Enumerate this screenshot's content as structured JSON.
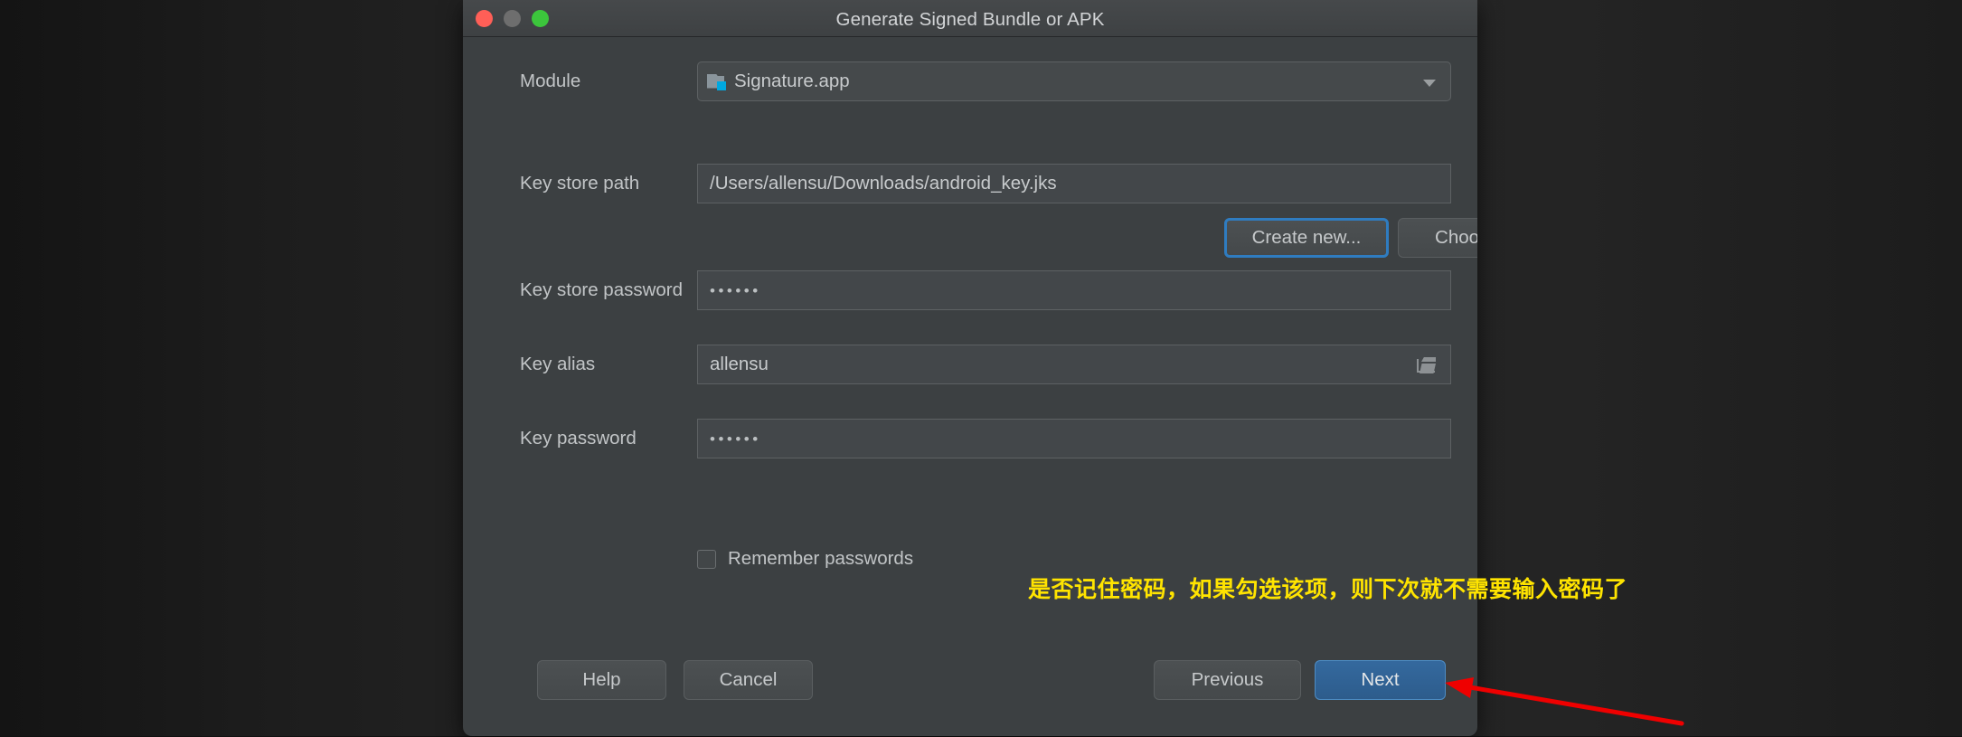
{
  "window": {
    "title": "Generate Signed Bundle or APK",
    "traffic_lights": [
      {
        "name": "close",
        "color": "#ff5f57"
      },
      {
        "name": "minimize",
        "color": "#6e6e6e"
      },
      {
        "name": "zoom",
        "color": "#3cc63c"
      }
    ]
  },
  "form": {
    "module": {
      "label": "Module",
      "value": "Signature.app",
      "icon": "module-folder-icon",
      "dropdown_icon": "chevron-down-icon"
    },
    "key_store_path": {
      "label": "Key store path",
      "value": "/Users/allensu/Downloads/android_key.jks"
    },
    "create_new": {
      "label": "Create new..."
    },
    "choose_existing": {
      "label": "Choose existing..."
    },
    "key_store_password": {
      "label": "Key store password",
      "value": "••••••"
    },
    "key_alias": {
      "label": "Key alias",
      "value": "allensu",
      "browse_icon": "folder-open-icon"
    },
    "key_password": {
      "label": "Key password",
      "value": "••••••"
    },
    "remember_passwords": {
      "label": "Remember passwords",
      "checked": false
    }
  },
  "footer": {
    "help": "Help",
    "cancel": "Cancel",
    "previous": "Previous",
    "next": "Next"
  },
  "annotation": {
    "text": "是否记住密码，如果勾选该项，则下次就不需要输入密码了",
    "color": "#ffe400",
    "arrow_color": "#ef0000"
  },
  "colors": {
    "dialog_background": "#3c4042",
    "titlebar": "#434648",
    "field_background": "#4a4e50",
    "accent_focus": "#2f7cc0",
    "default_button": "#34699e",
    "module_badge": "#00a8e0"
  }
}
